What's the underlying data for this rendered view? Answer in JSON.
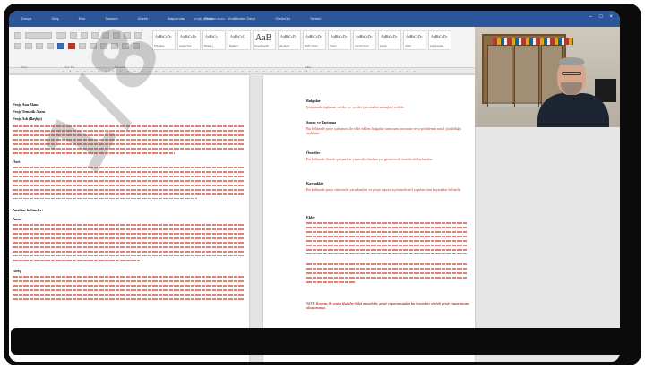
{
  "titlebar": {
    "menu": [
      "Dosya",
      "Giriş",
      "Ekle",
      "Tasarım",
      "Düzen",
      "Başvurular",
      "Posta",
      "Gözden Geçir",
      "Görünüm",
      "Yardım"
    ],
    "doc_title": "proje_sablonu.docx - Word"
  },
  "ribbon": {
    "styles": [
      {
        "sample": "AaBbCcDc",
        "name": "¶ Normal"
      },
      {
        "sample": "AaBbCcDc",
        "name": "Aralık Yok"
      },
      {
        "sample": "AaBbCc",
        "name": "Başlık 1"
      },
      {
        "sample": "AaBbCcC",
        "name": "Başlık 2"
      },
      {
        "sample": "AaB",
        "name": "Konu Başlığı",
        "big": true
      },
      {
        "sample": "AaBbCcD",
        "name": "Alt Konu"
      },
      {
        "sample": "AaBbCcDc",
        "name": "Hafif Vurgu"
      },
      {
        "sample": "AaBbCcDc",
        "name": "Vurgu"
      },
      {
        "sample": "AaBbCcDc",
        "name": "Güçlü Vurgu"
      },
      {
        "sample": "AaBbCcDc",
        "name": "Güçlü"
      },
      {
        "sample": "AaBbCcDc",
        "name": "Alıntı"
      },
      {
        "sample": "AaBbCcDc",
        "name": "Güçlü Alıntı"
      }
    ],
    "groups": [
      "Pano",
      "Yazı Tipi",
      "Paragraf",
      "Stiller"
    ]
  },
  "left_page": {
    "fields": [
      "Proje Ana Alanı",
      "Proje Tematik Alanı",
      "Proje Adı (Başlığı)"
    ],
    "headings": [
      "Özet",
      "Anahtar kelimeler:",
      "Amaç",
      "Giriş"
    ],
    "bottom_line": "... ve literatür özetinin ortaya konulması ve sorunun tanımlanması ..."
  },
  "right_page": {
    "headings": [
      "Bulgular",
      "Sonuç ve Tartışma",
      "Öneriler",
      "Kaynaklar",
      "Ekler"
    ],
    "lines": [
      "Çalışmada toplanan veriler ve veriler için analiz sonuçları verilir.",
      "Bu bölümde proje çalışması ile elde edilen bulgular sonucunu sorunun veya problemin nasıl çözüldüğü açıklanır.",
      "Bu bölümde ileride çalışmalar yapacak olanlara yol gösterecek önerilerde bulunulur.",
      "Bu bölümde proje sürecinde yararlanılan ve proje raporu içerisinde atıf yapılan tüm kaynaklar belirtilir.",
      "NOT: Kırmızı ile yazılı ifadeler bilgi amaçlıdır, proje raporunuzdan bu kısımları silerek proje raporunuzu oluşturunuz."
    ]
  },
  "watermark": "1/8",
  "colors": {
    "accent": "#2b579a",
    "instruction_text": "#c0392b"
  }
}
